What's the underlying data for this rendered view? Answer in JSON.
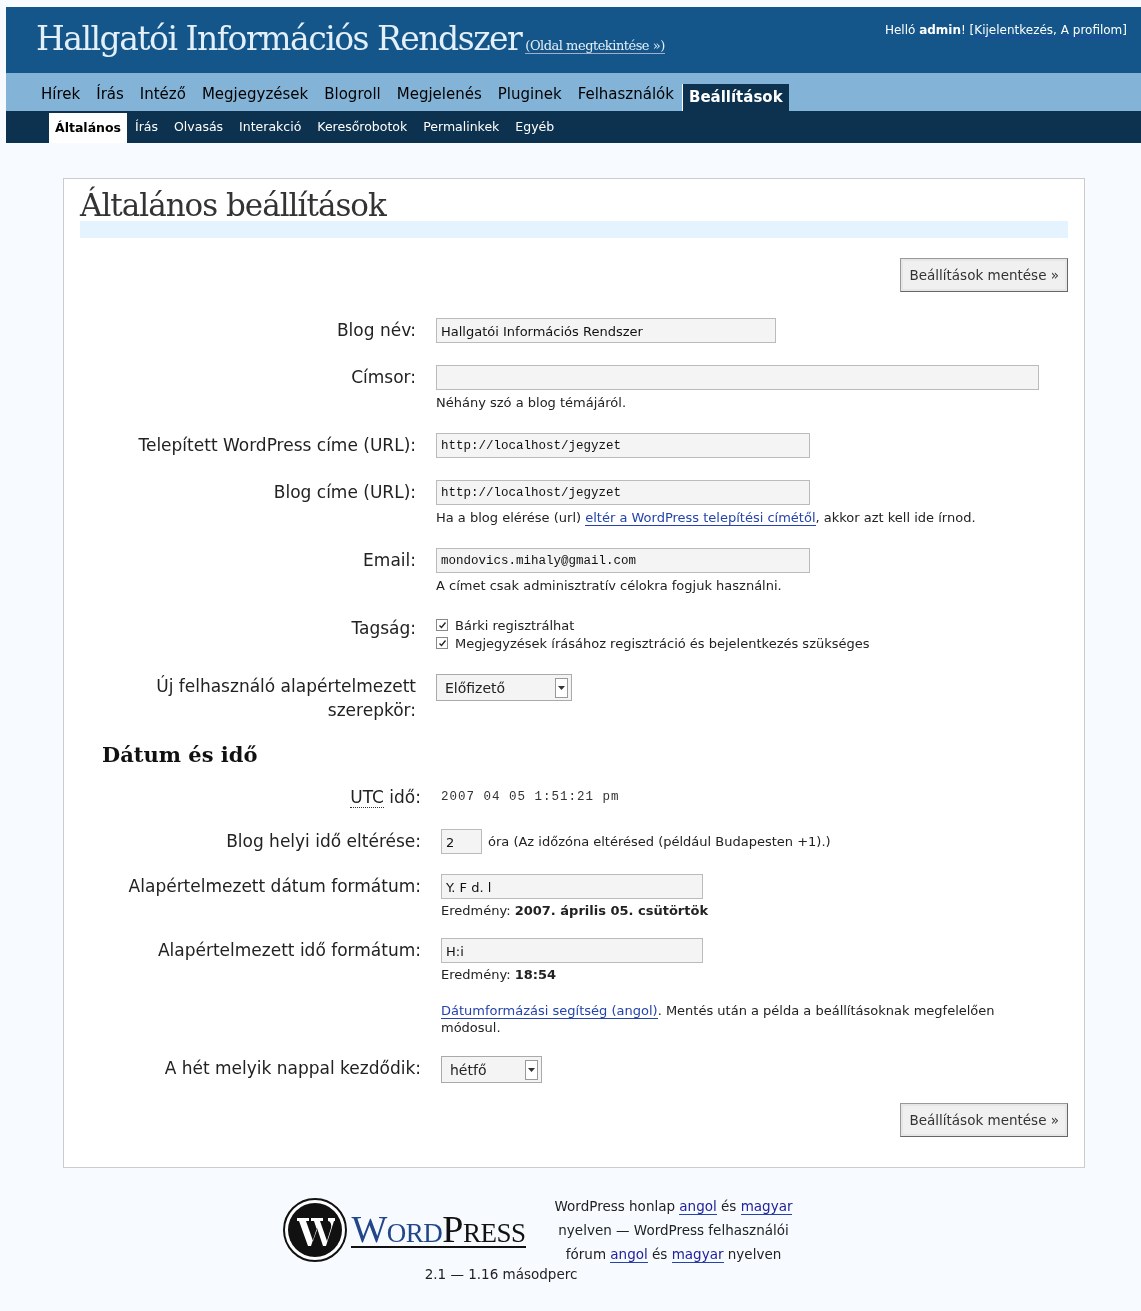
{
  "header": {
    "site_title": "Hallgatói Információs Rendszer",
    "view_link": "(Oldal megtekintése »)",
    "user_line": [
      {
        "text": "Helló "
      },
      {
        "text": "admin",
        "bold": true
      },
      {
        "text": "! ["
      },
      {
        "text": "Kijelentkezés",
        "link": true
      },
      {
        "text": ", "
      },
      {
        "text": "A profilom",
        "link": true
      },
      {
        "text": "]"
      }
    ]
  },
  "main_menu": [
    {
      "label": "Hírek",
      "selected": false
    },
    {
      "label": "Írás",
      "selected": false
    },
    {
      "label": "Intéző",
      "selected": false
    },
    {
      "label": "Megjegyzések",
      "selected": false
    },
    {
      "label": "Blogroll",
      "selected": false
    },
    {
      "label": "Megjelenés",
      "selected": false
    },
    {
      "label": "Pluginek",
      "selected": false
    },
    {
      "label": "Felhasználók",
      "selected": false
    },
    {
      "label": "Beállítások",
      "selected": true
    }
  ],
  "sub_menu": [
    {
      "label": "Általános",
      "selected": true
    },
    {
      "label": "Írás",
      "selected": false
    },
    {
      "label": "Olvasás",
      "selected": false
    },
    {
      "label": "Interakció",
      "selected": false
    },
    {
      "label": "Keresőrobotok",
      "selected": false
    },
    {
      "label": "Permalinkek",
      "selected": false
    },
    {
      "label": "Egyéb",
      "selected": false
    }
  ],
  "page_title": "Általános beállítások",
  "save_button_top": "Beállítások mentése »",
  "general_rows": [
    {
      "kind": "text",
      "label": "Blog név:",
      "value": "Hallgatói Információs Rendszer"
    },
    {
      "kind": "text",
      "label": "Címsor:",
      "note": [
        {
          "text": "Néhány szó a blog témájáról."
        }
      ]
    },
    {
      "kind": "mono",
      "label": "Telepített WordPress címe (URL):",
      "value": "http://localhost/jegyzet"
    },
    {
      "kind": "mono",
      "label": "Blog címe (URL):",
      "value": "http://localhost/jegyzet",
      "note": [
        {
          "text": "Ha a blog elérése (url) "
        },
        {
          "text": "eltér a WordPress telepítési címétől",
          "link": true
        },
        {
          "text": ", akkor azt kell ide írnod."
        }
      ]
    },
    {
      "kind": "mono",
      "label": "Email:",
      "value": "mondovics.mihaly@gmail.com",
      "note": [
        {
          "text": "A címet csak adminisztratív célokra fogjuk használni."
        }
      ]
    },
    {
      "kind": "checkboxes",
      "label": "Tagság:",
      "options": [
        {
          "label": "Bárki regisztrálhat",
          "checked": true
        },
        {
          "label": "Megjegyzések írásához regisztráció és bejelentkezés szükséges",
          "checked": true
        }
      ]
    },
    {
      "kind": "select",
      "label": "Új felhasználó alapértelmezett szerepkör:",
      "value": "Előfizető"
    }
  ],
  "date_heading": "Dátum és idő",
  "date_rows": [
    {
      "kind": "static",
      "label": "idő:",
      "abbr": "UTC",
      "value": "2007 04 05 1:51:21 pm"
    },
    {
      "kind": "offset",
      "label": "Blog helyi idő eltérése:",
      "value": "2",
      "suffix": "óra (Az időzóna eltérésed (például Budapesten +1).)"
    },
    {
      "kind": "text",
      "label": "Alapértelmezett dátum formátum:",
      "value": "Y. F d. l",
      "result": "Eredmény: **2007. április 05. csütörtök**"
    },
    {
      "kind": "text",
      "label": "Alapértelmezett idő formátum:",
      "value": "H:i",
      "result": "Eredmény: **18:54**",
      "note": [
        {
          "text": "Dátumformázási segítség (angol)",
          "link": true
        },
        {
          "text": ". Mentés után a példa a beállításoknak megfelelően módosul."
        }
      ]
    },
    {
      "kind": "select",
      "label": "A hét melyik nappal kezdődik:",
      "value": "hétfő"
    }
  ],
  "save_button_bottom": "Beállítások mentése »",
  "footer": {
    "logo_parts": [
      "Word",
      "Press"
    ],
    "links_text": [
      {
        "text": "WordPress honlap "
      },
      {
        "text": "angol",
        "link": true
      },
      {
        "text": " és "
      },
      {
        "text": "magyar",
        "link": true
      },
      {
        "text": " nyelven — WordPress felhasználói fórum "
      },
      {
        "text": "angol",
        "link": true
      },
      {
        "text": " és "
      },
      {
        "text": "magyar",
        "link": true
      },
      {
        "text": " nyelven"
      }
    ],
    "timing": "2.1 — 1.16 másodperc"
  }
}
